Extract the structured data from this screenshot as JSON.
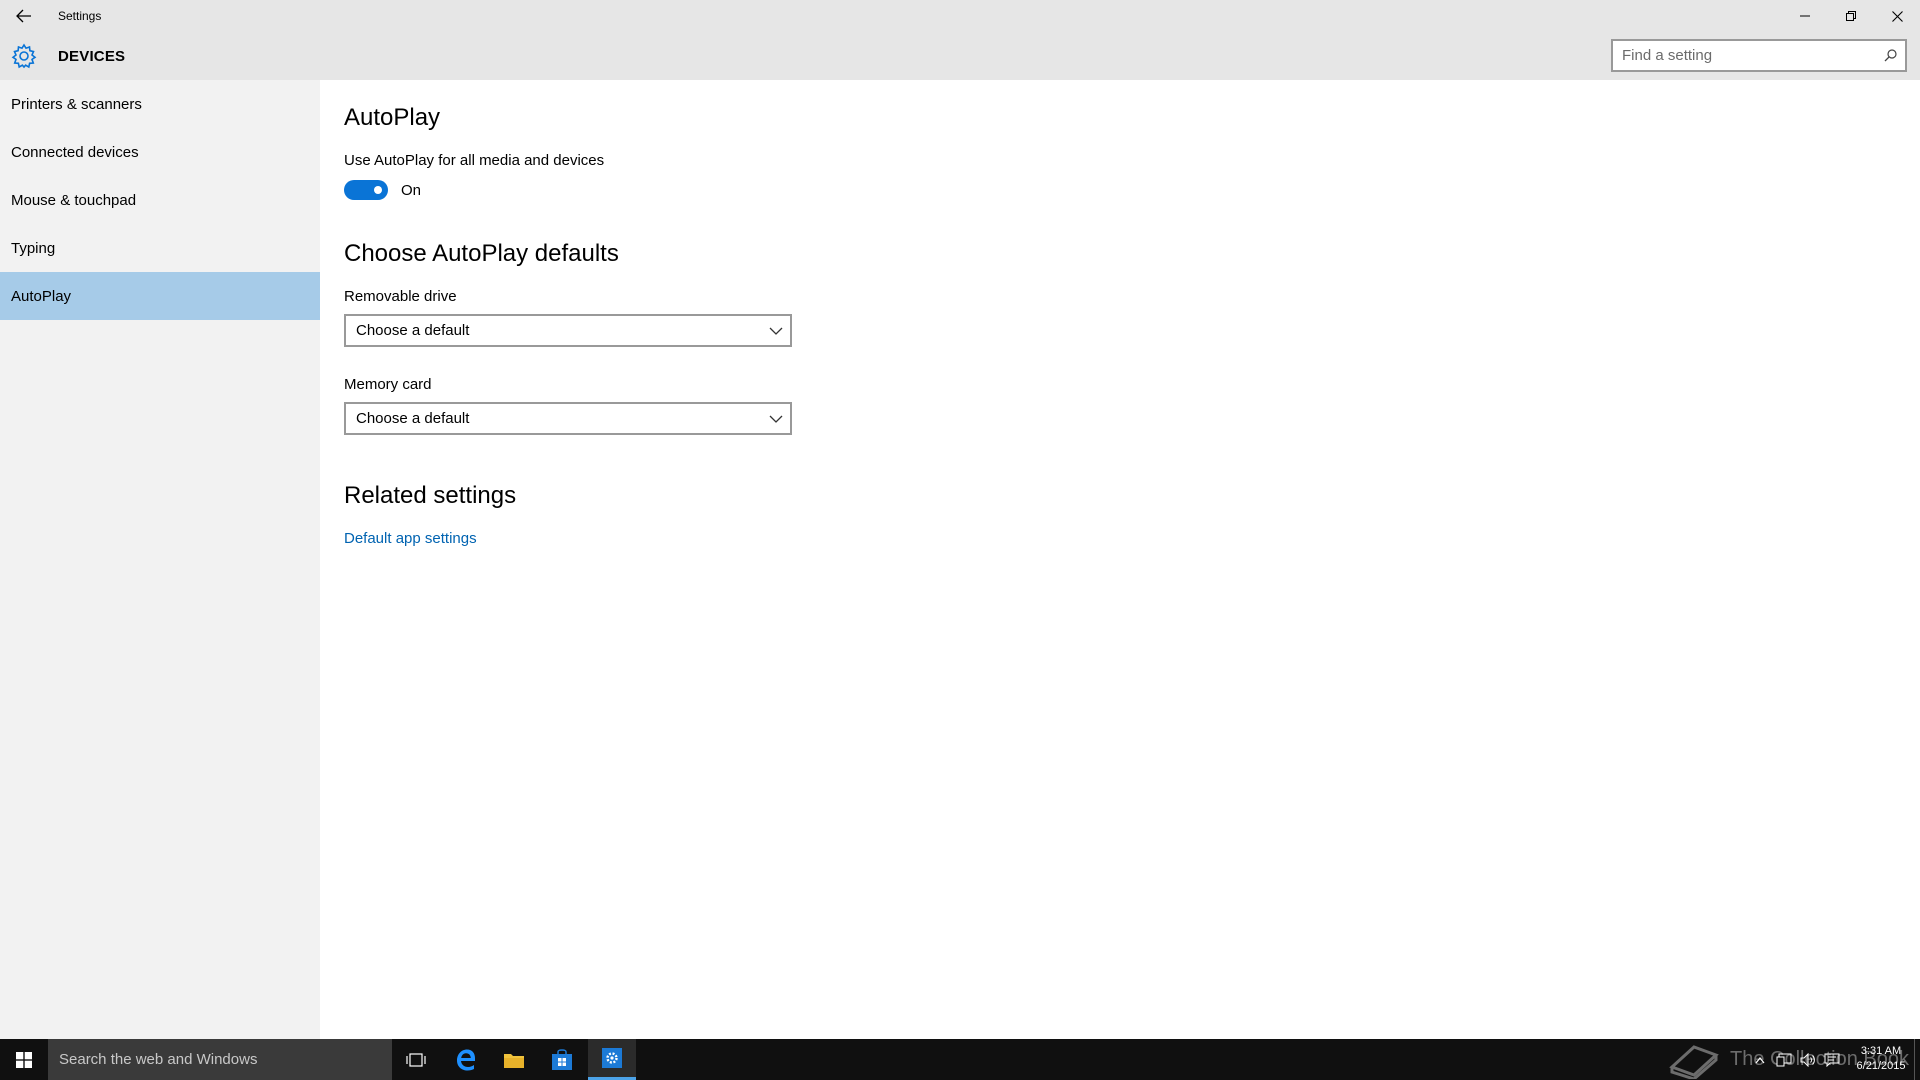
{
  "window": {
    "title": "Settings",
    "controls": {
      "minimize": "minimize-icon",
      "restore": "restore-icon",
      "close": "close-icon"
    }
  },
  "header": {
    "section_title": "DEVICES",
    "search_placeholder": "Find a setting"
  },
  "sidebar": {
    "items": [
      {
        "label": "Printers & scanners",
        "active": false
      },
      {
        "label": "Connected devices",
        "active": false
      },
      {
        "label": "Mouse & touchpad",
        "active": false
      },
      {
        "label": "Typing",
        "active": false
      },
      {
        "label": "AutoPlay",
        "active": true
      }
    ]
  },
  "main": {
    "title": "AutoPlay",
    "toggle_label": "Use AutoPlay for all media and devices",
    "toggle_state": "On",
    "defaults_title": "Choose AutoPlay defaults",
    "removable_drive": {
      "label": "Removable drive",
      "value": "Choose a default"
    },
    "memory_card": {
      "label": "Memory card",
      "value": "Choose a default"
    },
    "related_title": "Related settings",
    "related_link": "Default app settings"
  },
  "taskbar": {
    "search_text": "Search the web and Windows",
    "apps": [
      "task-view-icon",
      "edge-icon",
      "file-explorer-icon",
      "store-icon",
      "settings-icon"
    ],
    "watermark": "The Collection Book",
    "time": "3:31 AM",
    "date": "6/21/2015"
  },
  "colors": {
    "accent": "#0a74d6",
    "selected_nav": "#a6cbe8",
    "chrome": "#e6e6e6",
    "sidebar": "#f2f2f2",
    "link": "#0063b1",
    "taskbar": "#101010"
  }
}
